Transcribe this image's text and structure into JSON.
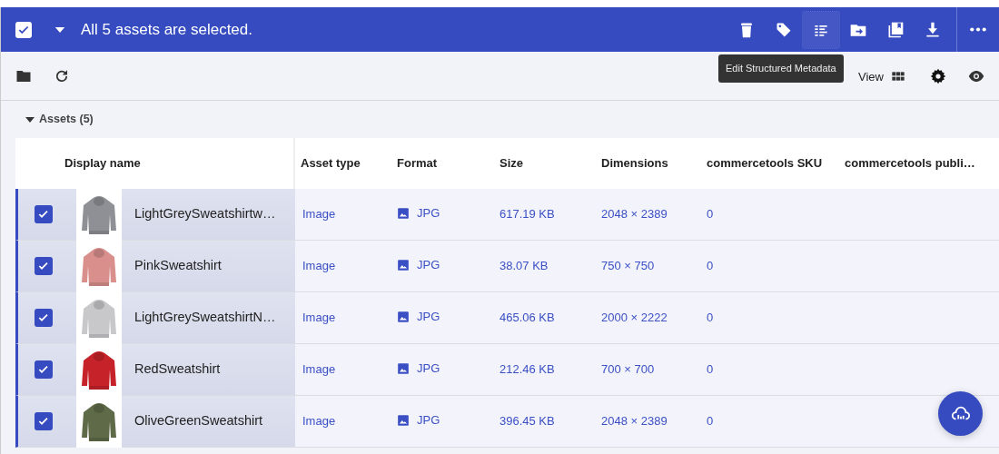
{
  "selection_bar": {
    "select_all_checked": true,
    "message": "All 5 assets are selected.",
    "actions": [
      {
        "kind": "delete",
        "focused": false
      },
      {
        "kind": "tag",
        "focused": false
      },
      {
        "kind": "metadata",
        "focused": true
      },
      {
        "kind": "move",
        "focused": false
      },
      {
        "kind": "collection",
        "focused": false
      },
      {
        "kind": "download",
        "focused": false
      }
    ],
    "tooltip": "Edit Structured Metadata"
  },
  "toolbar": {
    "view_label": "View"
  },
  "section": {
    "title": "Assets (5)",
    "expanded": true
  },
  "table": {
    "columns": [
      "Display name",
      "Asset type",
      "Format",
      "Size",
      "Dimensions",
      "commercetools SKU",
      "commercetools publi…"
    ],
    "rows": [
      {
        "selected": true,
        "name": "LightGreySweatshirtw…",
        "type": "Image",
        "format": "JPG",
        "size": "617.19 KB",
        "dimensions": "2048 × 2389",
        "sku": "0"
      },
      {
        "selected": true,
        "name": "PinkSweatshirt",
        "type": "Image",
        "format": "JPG",
        "size": "38.07 KB",
        "dimensions": "750 × 750",
        "sku": "0"
      },
      {
        "selected": true,
        "name": "LightGreySweatshirtN…",
        "type": "Image",
        "format": "JPG",
        "size": "465.06 KB",
        "dimensions": "2000 × 2222",
        "sku": "0"
      },
      {
        "selected": true,
        "name": "RedSweatshirt",
        "type": "Image",
        "format": "JPG",
        "size": "212.46 KB",
        "dimensions": "700 × 700",
        "sku": "0"
      },
      {
        "selected": true,
        "name": "OliveGreenSweatshirt",
        "type": "Image",
        "format": "JPG",
        "size": "396.45 KB",
        "dimensions": "2048 × 2389",
        "sku": "0"
      }
    ]
  }
}
